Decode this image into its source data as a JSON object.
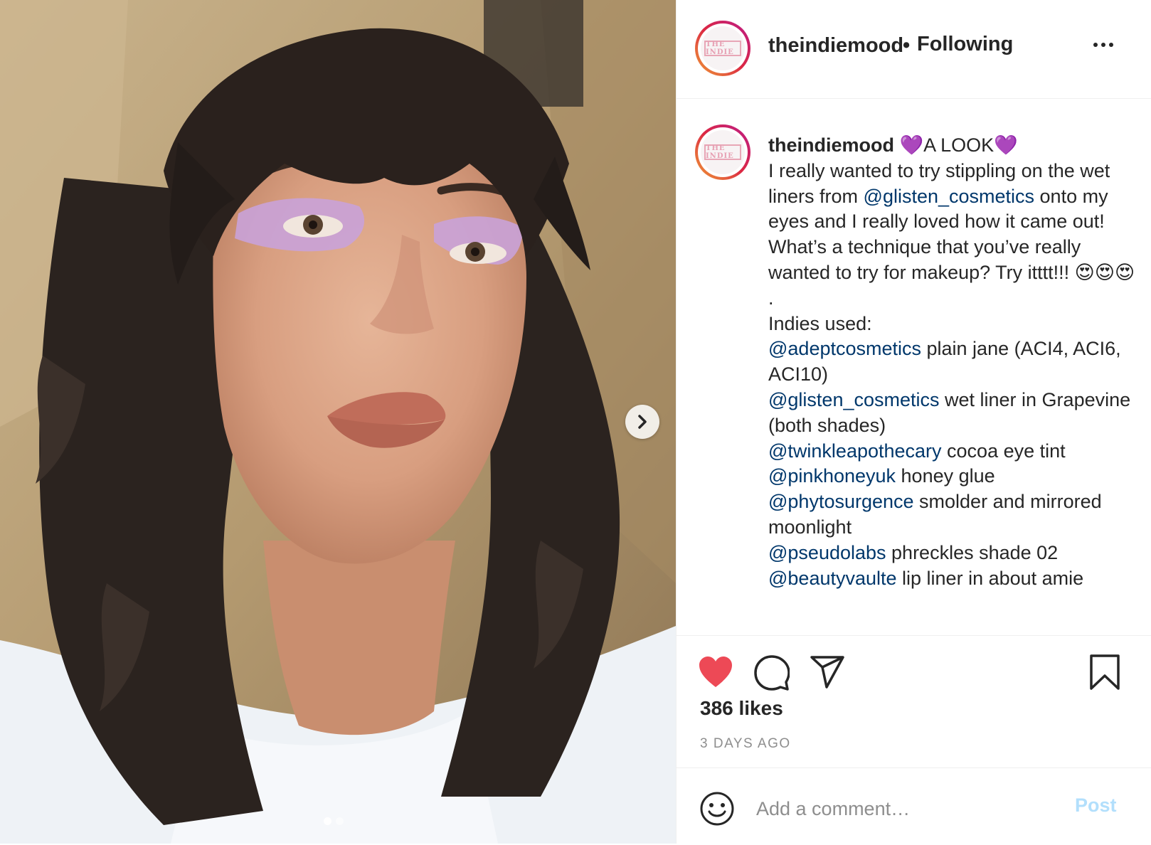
{
  "post": {
    "media": {
      "slides_total": 2,
      "active_slide": 1,
      "next_icon": "chevron-right-icon"
    },
    "header": {
      "username": "theindiemood",
      "separator": "•",
      "follow_status": "Following",
      "more_icon": "more-icon",
      "avatar_logo_text": "THE INDIE"
    },
    "caption": {
      "username": "theindiemood",
      "title_emoji": "💜",
      "title_text": "A LOOK",
      "line1": "I really wanted to try stippling on the wet liners from ",
      "mention1": "@glisten_cosmetics",
      "line2": " onto my eyes and I really loved how it came out! What’s a technique that you’ve really wanted to try for makeup? Try itttt!!! ",
      "emojis": "😍😍😍",
      "dot": ".",
      "indies_header": "Indies used:",
      "products": [
        {
          "mention": "@adeptcosmetics",
          "text": " plain jane (ACI4, ACI6, ACI10)"
        },
        {
          "mention": "@glisten_cosmetics",
          "text": " wet liner in Grapevine (both shades)"
        },
        {
          "mention": "@twinkleapothecary",
          "text": " cocoa eye tint"
        },
        {
          "mention": "@pinkhoneyuk",
          "text": " honey glue"
        },
        {
          "mention": "@phytosurgence",
          "text": " smolder and mirrored moonlight"
        },
        {
          "mention": "@pseudolabs",
          "text": " phreckles shade 02"
        },
        {
          "mention": "@beautyvaulte",
          "text": " lip liner in about amie"
        }
      ]
    },
    "actions": {
      "like_icon": "heart-filled-icon",
      "comment_icon": "comment-icon",
      "share_icon": "send-icon",
      "save_icon": "bookmark-icon",
      "like_color": "#ed4956",
      "likes_text": "386 likes",
      "timestamp": "3 DAYS AGO"
    },
    "comment_box": {
      "emoji_icon": "smiley-icon",
      "placeholder": "Add a comment…",
      "post_label": "Post",
      "post_color": "#b2dffc"
    },
    "colors": {
      "mention": "#00376b",
      "text": "#262626",
      "muted": "#8e8e8e",
      "border": "#efefef"
    }
  }
}
